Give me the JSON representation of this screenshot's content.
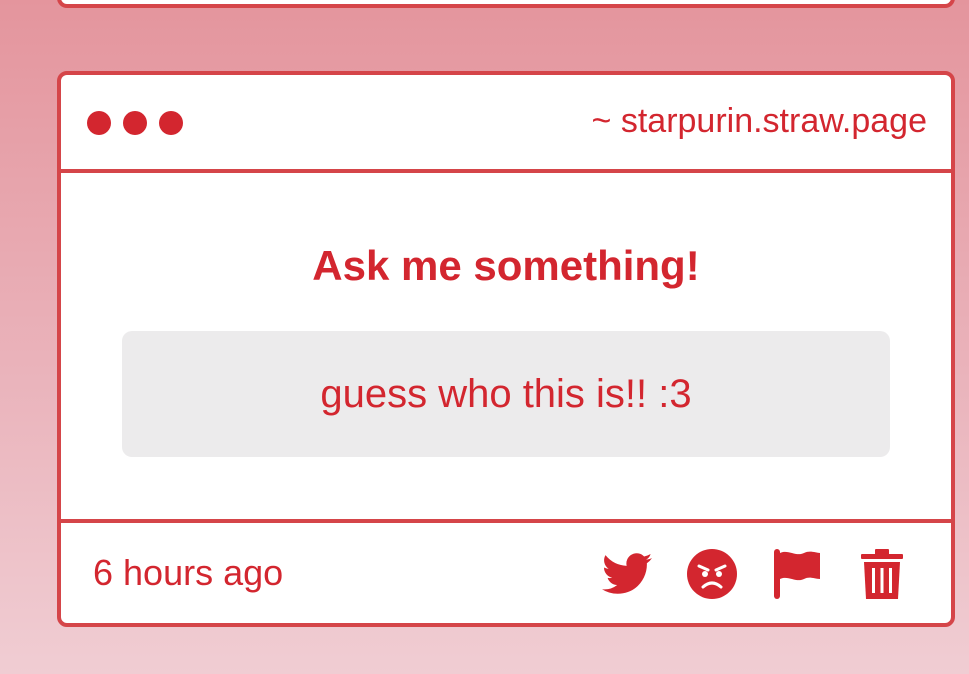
{
  "theme": {
    "accent": "#d3262f",
    "border": "#d54549",
    "card_background": "#ffffff",
    "question_background": "#ecebec"
  },
  "window": {
    "dots": [
      "dot",
      "dot",
      "dot"
    ],
    "url": "~ starpurin.straw.page"
  },
  "prompt": {
    "heading": "Ask me something!",
    "question": "guess who this is!! :3"
  },
  "footer": {
    "timestamp": "6 hours ago",
    "actions": [
      {
        "icon": "twitter-icon",
        "name": "share-twitter-button"
      },
      {
        "icon": "angry-face-icon",
        "name": "react-angry-button"
      },
      {
        "icon": "flag-icon",
        "name": "report-button"
      },
      {
        "icon": "trash-icon",
        "name": "delete-button"
      }
    ]
  }
}
